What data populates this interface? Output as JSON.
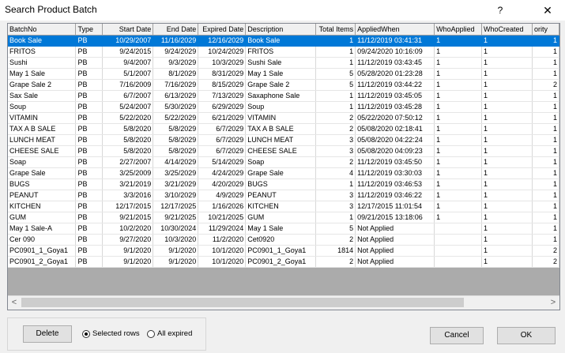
{
  "window": {
    "title": "Search Product Batch",
    "help_glyph": "?",
    "close_glyph": "✕"
  },
  "grid": {
    "columns": [
      "BatchNo",
      "Type",
      "Start Date",
      "End Date",
      "Expired Date",
      "Description",
      "Total Items",
      "AppliedWhen",
      "WhoApplied",
      "WhoCreated",
      "ority"
    ],
    "rows": [
      [
        "Book Sale",
        "PB",
        "10/29/2007",
        "11/16/2029",
        "12/16/2029",
        "Book Sale",
        "1",
        "11/12/2019 03:41:31",
        "1",
        "1",
        "1"
      ],
      [
        "FRITOS",
        "PB",
        "9/24/2015",
        "9/24/2029",
        "10/24/2029",
        "FRITOS",
        "1",
        "09/24/2020 10:16:09",
        "1",
        "1",
        "1"
      ],
      [
        "Sushi",
        "PB",
        "9/4/2007",
        "9/3/2029",
        "10/3/2029",
        "Sushi Sale",
        "1",
        "11/12/2019 03:43:45",
        "1",
        "1",
        "1"
      ],
      [
        "May 1 Sale",
        "PB",
        "5/1/2007",
        "8/1/2029",
        "8/31/2029",
        "May 1 Sale",
        "5",
        "05/28/2020 01:23:28",
        "1",
        "1",
        "1"
      ],
      [
        "Grape Sale 2",
        "PB",
        "7/16/2009",
        "7/16/2029",
        "8/15/2029",
        "Grape Sale 2",
        "5",
        "11/12/2019 03:44:22",
        "1",
        "1",
        "2"
      ],
      [
        "Sax Sale",
        "PB",
        "6/7/2007",
        "6/13/2029",
        "7/13/2029",
        "Saxaphone Sale",
        "1",
        "11/12/2019 03:45:05",
        "1",
        "1",
        "1"
      ],
      [
        "Soup",
        "PB",
        "5/24/2007",
        "5/30/2029",
        "6/29/2029",
        "Soup",
        "1",
        "11/12/2019 03:45:28",
        "1",
        "1",
        "1"
      ],
      [
        "VITAMIN",
        "PB",
        "5/22/2020",
        "5/22/2029",
        "6/21/2029",
        "VITAMIN",
        "2",
        "05/22/2020 07:50:12",
        "1",
        "1",
        "1"
      ],
      [
        "TAX A B SALE",
        "PB",
        "5/8/2020",
        "5/8/2029",
        "6/7/2029",
        "TAX A B SALE",
        "2",
        "05/08/2020 02:18:41",
        "1",
        "1",
        "1"
      ],
      [
        "LUNCH MEAT",
        "PB",
        "5/8/2020",
        "5/8/2029",
        "6/7/2029",
        "LUNCH MEAT",
        "3",
        "05/08/2020 04:22:24",
        "1",
        "1",
        "1"
      ],
      [
        "CHEESE SALE",
        "PB",
        "5/8/2020",
        "5/8/2029",
        "6/7/2029",
        "CHEESE SALE",
        "3",
        "05/08/2020 04:09:23",
        "1",
        "1",
        "1"
      ],
      [
        "Soap",
        "PB",
        "2/27/2007",
        "4/14/2029",
        "5/14/2029",
        "Soap",
        "2",
        "11/12/2019 03:45:50",
        "1",
        "1",
        "1"
      ],
      [
        "Grape Sale",
        "PB",
        "3/25/2009",
        "3/25/2029",
        "4/24/2029",
        "Grape Sale",
        "4",
        "11/12/2019 03:30:03",
        "1",
        "1",
        "1"
      ],
      [
        "BUGS",
        "PB",
        "3/21/2019",
        "3/21/2029",
        "4/20/2029",
        "BUGS",
        "1",
        "11/12/2019 03:46:53",
        "1",
        "1",
        "1"
      ],
      [
        "PEANUT",
        "PB",
        "3/3/2016",
        "3/10/2029",
        "4/9/2029",
        "PEANUT",
        "3",
        "11/12/2019 03:46:22",
        "1",
        "1",
        "1"
      ],
      [
        "KITCHEN",
        "PB",
        "12/17/2015",
        "12/17/2025",
        "1/16/2026",
        "KITCHEN",
        "3",
        "12/17/2015 11:01:54",
        "1",
        "1",
        "1"
      ],
      [
        "GUM",
        "PB",
        "9/21/2015",
        "9/21/2025",
        "10/21/2025",
        "GUM",
        "1",
        "09/21/2015 13:18:06",
        "1",
        "1",
        "1"
      ],
      [
        "May 1 Sale-A",
        "PB",
        "10/2/2020",
        "10/30/2024",
        "11/29/2024",
        "May 1 Sale",
        "5",
        "Not Applied",
        "",
        "1",
        "1"
      ],
      [
        "Cer 090",
        "PB",
        "9/27/2020",
        "10/3/2020",
        "11/2/2020",
        "Cet0920",
        "2",
        "Not Applied",
        "",
        "1",
        "1"
      ],
      [
        "PC0901_1_Goya1",
        "PB",
        "9/1/2020",
        "9/1/2020",
        "10/1/2020",
        "PC0901_1_Goya1",
        "1814",
        "Not Applied",
        "",
        "1",
        "2"
      ],
      [
        "PC0901_2_Goya1",
        "PB",
        "9/1/2020",
        "9/1/2020",
        "10/1/2020",
        "PC0901_2_Goya1",
        "2",
        "Not Applied",
        "",
        "1",
        "2"
      ]
    ],
    "selected_row": 0
  },
  "scroll": {
    "left_glyph": "<",
    "right_glyph": ">"
  },
  "footer": {
    "delete_label": "Delete",
    "radio_selected_label": "Selected rows",
    "radio_all_label": "All expired",
    "cancel_label": "Cancel",
    "ok_label": "OK"
  },
  "colors": {
    "selection": "#0078d7",
    "grid_empty": "#ababab"
  }
}
